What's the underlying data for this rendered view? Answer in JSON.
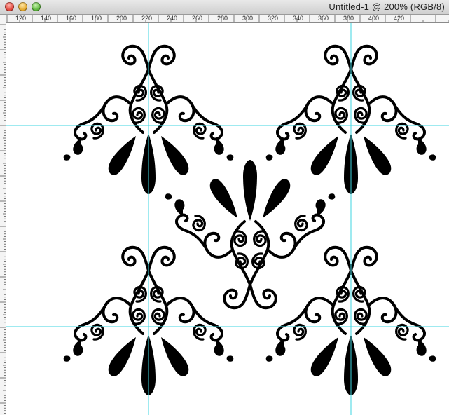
{
  "window": {
    "title": "Untitled-1 @ 200% (RGB/8)",
    "buttons": [
      "close",
      "minimize",
      "zoom"
    ]
  },
  "ruler": {
    "labels": [
      "120",
      "140",
      "160",
      "180",
      "200",
      "220",
      "240",
      "260",
      "280",
      "300",
      "320",
      "340",
      "360",
      "380",
      "400",
      "420"
    ]
  },
  "canvas": {
    "guide_color": "#3fd6e0",
    "ornament_color": "#000000",
    "background": "#ffffff"
  },
  "icons": {
    "close": "close-icon",
    "minimize": "minimize-icon",
    "zoom": "zoom-icon"
  }
}
